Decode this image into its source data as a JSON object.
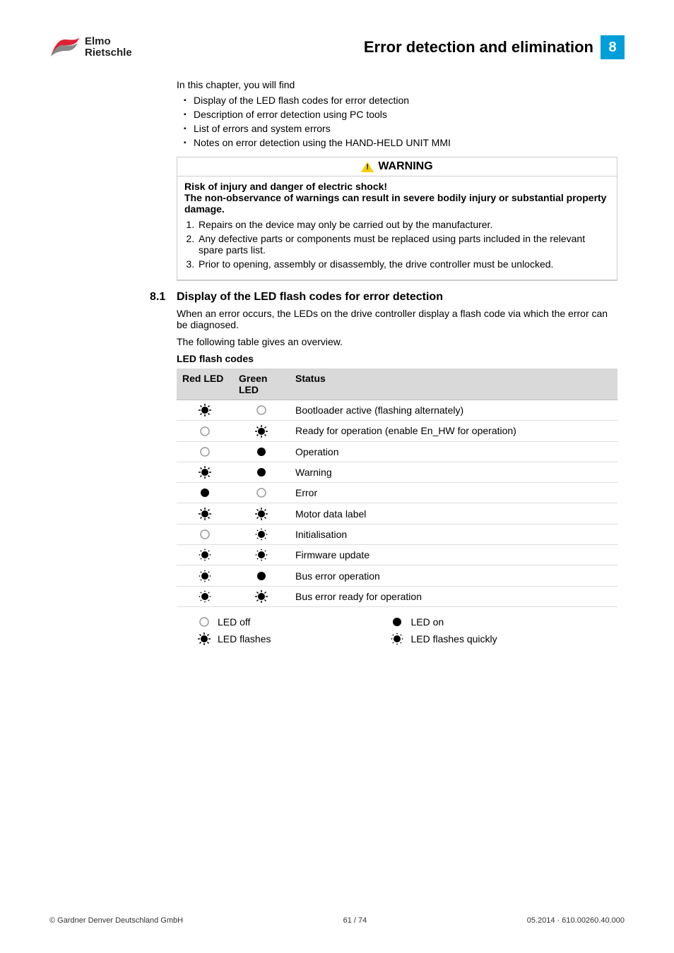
{
  "logo": {
    "line1": "Elmo",
    "line2": "Rietschle"
  },
  "chapter": {
    "title": "Error detection and elimination",
    "number": "8"
  },
  "intro": "In this chapter, you will find",
  "bullets": [
    "Display of the LED flash codes for error detection",
    "Description of error detection using PC tools",
    "List of errors and system errors",
    "Notes on error detection using the HAND-HELD UNIT MMI"
  ],
  "warning": {
    "header": "WARNING",
    "risk_line1": "Risk of injury and danger of electric shock!",
    "risk_line2": "The non-observance of warnings can result in severe bodily injury or substantial property damage.",
    "items": [
      "Repairs on the device may only be carried out by the manufacturer.",
      "Any defective parts or components must be replaced using parts included in the relevant spare parts list.",
      "Prior to opening, assembly or disassembly, the drive controller must be unlocked."
    ]
  },
  "section": {
    "num": "8.1",
    "title": "Display of the LED flash codes for error detection",
    "p1": "When an error occurs, the LEDs on the drive controller display a flash code via which the error can be diagnosed.",
    "p2": "The following table gives an overview.",
    "table_caption": "LED flash codes",
    "headers": {
      "red": "Red LED",
      "green": "Green LED",
      "status": "Status"
    },
    "rows": [
      {
        "red": "flash",
        "green": "off",
        "status": "Bootloader active (flashing alternately)"
      },
      {
        "red": "off",
        "green": "flash",
        "status": "Ready for operation (enable En_HW for operation)"
      },
      {
        "red": "off",
        "green": "on",
        "status": "Operation"
      },
      {
        "red": "flash",
        "green": "on",
        "status": "Warning"
      },
      {
        "red": "on",
        "green": "off",
        "status": "Error"
      },
      {
        "red": "flash",
        "green": "flash",
        "status": "Motor data label"
      },
      {
        "red": "off",
        "green": "quick",
        "status": "Initialisation"
      },
      {
        "red": "quick",
        "green": "quick",
        "status": "Firmware update"
      },
      {
        "red": "quick",
        "green": "on",
        "status": "Bus error operation"
      },
      {
        "red": "quick",
        "green": "flash",
        "status": "Bus error ready for operation"
      }
    ]
  },
  "legend": {
    "off": "LED off",
    "on": "LED on",
    "flash": "LED flashes",
    "quick": "LED flashes quickly"
  },
  "footer": {
    "left": "© Gardner Denver Deutschland GmbH",
    "center": "61 / 74",
    "right": "05.2014 · 610.00260.40.000"
  }
}
